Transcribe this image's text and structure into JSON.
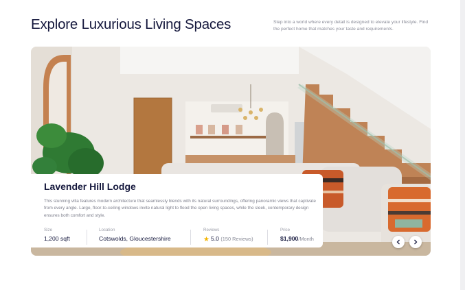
{
  "header": {
    "title": "Explore Luxurious Living Spaces",
    "intro": "Step into a world where every detail is designed to elevate your lifestyle. Find the perfect home that matches your taste and requirements."
  },
  "listing": {
    "name": "Lavender Hill Lodge",
    "description": "This stunning villa features modern architecture that seamlessly blends with its natural surroundings, offering panoramic views that captivate from every angle. Large, floor-to-ceiling windows invite natural light to flood the open living spaces, while the sleek, contemporary design ensures both comfort and style.",
    "size": {
      "label": "Size",
      "value": "1,200 sqft"
    },
    "location": {
      "label": "Location",
      "value": "Cotswolds, Gloucestershire"
    },
    "reviews": {
      "label": "Reviews",
      "rating": "5.0",
      "count": "(150 Reviews)",
      "icon": "star-icon"
    },
    "price": {
      "label": "Price",
      "value": "$1,900",
      "period": "/Month"
    }
  },
  "carousel": {
    "prev_icon": "chevron-left-icon",
    "next_icon": "chevron-right-icon"
  },
  "colors": {
    "heading": "#15183d",
    "star": "#f4b400",
    "wood": "#b87a4b"
  }
}
